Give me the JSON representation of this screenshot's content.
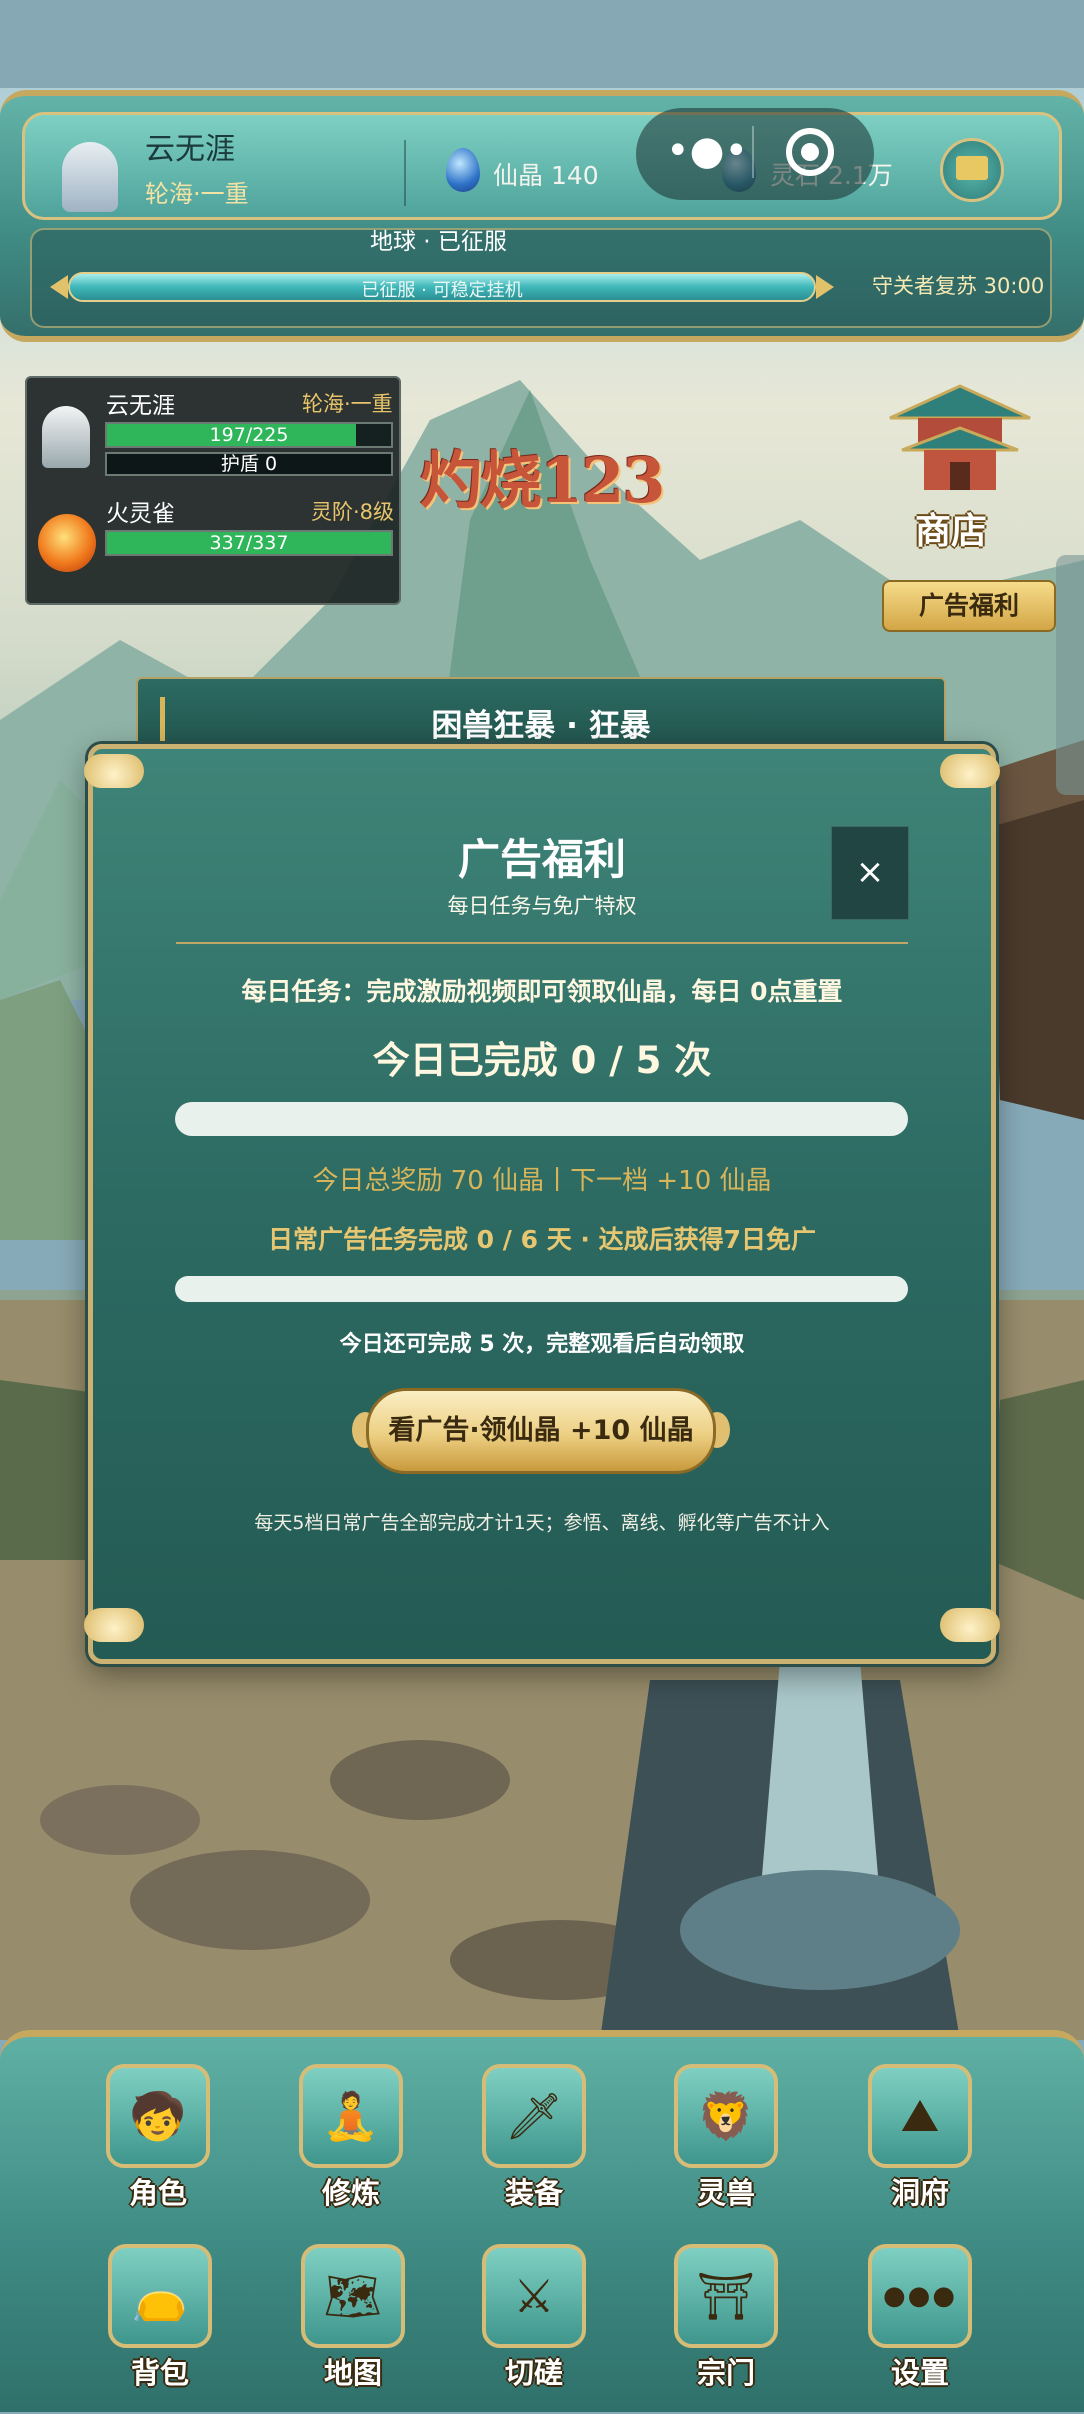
{
  "header": {
    "player_name": "云无涯",
    "realm": "轮海·一重",
    "currencies": [
      {
        "name": "仙晶",
        "value": "140",
        "icon": "blue-crystal-icon"
      },
      {
        "name": "灵石",
        "value": "2.1万",
        "icon": "spirit-stone-icon"
      }
    ],
    "currency1_text": "仙晶 140",
    "currency2_text": "灵石 2.1万",
    "mail_icon": "envelope-icon",
    "planet_status": "地球 · 已征服",
    "progress_text": "已征服 · 可稳定挂机",
    "guard_revive": "守关者复苏 30:00"
  },
  "system_capsule": {
    "menu_icon": "more-dots-icon",
    "close_icon": "target-icon"
  },
  "battle": {
    "player": {
      "name": "云无涯",
      "realm": "轮海·一重",
      "hp_text": "197/225",
      "hp_fraction": 0.876,
      "shield_text": "护盾 0"
    },
    "pet": {
      "name": "火灵雀",
      "level": "灵阶·8级",
      "hp_text": "337/337",
      "hp_fraction": 1.0
    }
  },
  "damage_popup": "灼烧123",
  "shop": {
    "label": "商店"
  },
  "ad_welfare_button": "广告福利",
  "boss_banner": "困兽狂暴 · 狂暴",
  "modal": {
    "title": "广告福利",
    "subtitle": "每日任务与免广特权",
    "close_label": "×",
    "task_description": "每日任务：完成激励视频即可领取仙晶，每日 0点重置",
    "today_progress": "今日已完成 0 / 5 次",
    "today_fraction": 0,
    "reward_info": "今日总奖励 70 仙晶丨下一档 +10 仙晶",
    "streak_info": "日常广告任务完成 0 / 6 天 · 达成后获得7日免广",
    "streak_fraction": 0,
    "remaining_info": "今日还可完成 5 次，完整观看后自动领取",
    "watch_button": "看广告·领仙晶  +10 仙晶",
    "footnote": "每天5档日常广告全部完成才计1天；参悟、离线、孵化等广告不计入"
  },
  "bottom_nav": {
    "row1": [
      {
        "label": "角色",
        "icon": "character-icon",
        "glyph": "🧒"
      },
      {
        "label": "修炼",
        "icon": "meditation-icon",
        "glyph": "🧘"
      },
      {
        "label": "装备",
        "icon": "equipment-icon",
        "glyph": "🗡"
      },
      {
        "label": "灵兽",
        "icon": "beast-icon",
        "glyph": "🦁"
      },
      {
        "label": "洞府",
        "icon": "cave-icon",
        "glyph": "⛰"
      }
    ],
    "row2": [
      {
        "label": "背包",
        "icon": "bag-icon",
        "glyph": "👝"
      },
      {
        "label": "地图",
        "icon": "map-icon",
        "glyph": "🗺"
      },
      {
        "label": "切磋",
        "icon": "crossed-swords-icon",
        "glyph": "⚔"
      },
      {
        "label": "宗门",
        "icon": "sect-hall-icon",
        "glyph": "⛩"
      },
      {
        "label": "设置",
        "icon": "settings-dots-icon",
        "glyph": "●●●"
      }
    ]
  }
}
